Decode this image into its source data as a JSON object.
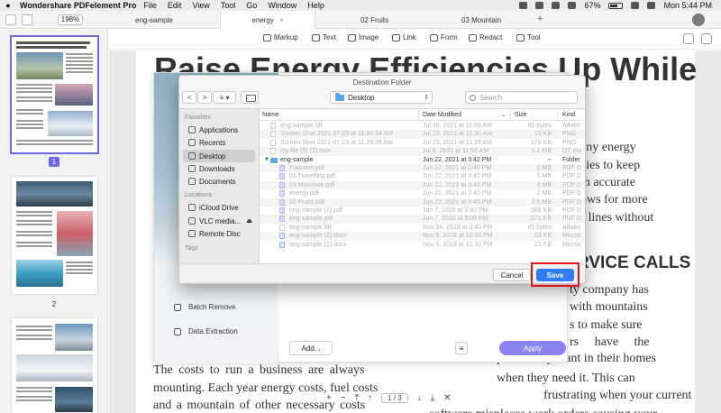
{
  "menubar": {
    "app_name": "Wondershare PDFelement Pro",
    "menus": [
      "File",
      "Edit",
      "View",
      "Tool",
      "Go",
      "Window",
      "Help"
    ],
    "battery": "67%",
    "clock": "Mon 5:44 PM",
    "battery_level": 0.67
  },
  "tabbar": {
    "zoom": "198%",
    "tabs": [
      "eng-sample",
      "energy",
      "02 Fruits",
      "03 Mountain"
    ],
    "active_tab": 1,
    "add": "+"
  },
  "toolbar": {
    "tools": [
      "Markup",
      "Text",
      "Image",
      "Link",
      "Form",
      "Redact",
      "Tool"
    ]
  },
  "thumbnails": {
    "pages": [
      "1",
      "2"
    ],
    "selected": 0
  },
  "document": {
    "heading_line1": "Raise Energy Efficiencies Up While",
    "heading_line2": "Re",
    "right_lines": [
      "ows any energy",
      "panies to keep",
      "with accurate",
      "allows for more",
      "the lines without",
      "n."
    ],
    "subhead": "RVICE CALLS",
    "right_lines2": [
      "ty company has",
      "with mountains",
      "s to make sure",
      "rs have the",
      "power they want in their homes",
      "when they need it. This can",
      "frustrating when your current",
      "software misplaces work orders causing your"
    ],
    "left_lines": [
      "The costs to run a business are always",
      "mounting. Each year energy costs, fuel costs",
      "and a mountain of other necessary costs"
    ]
  },
  "pagenav": {
    "current": "1",
    "total": "3",
    "separator": "/",
    "plus": "+",
    "minus": "−",
    "close": "✕"
  },
  "batch_panel": {
    "items": [
      "Batch Remove",
      "Data Extraction"
    ],
    "add_button": "Add...",
    "apply_button": "Apply"
  },
  "dialog": {
    "title": "Destination Folder",
    "back": "<",
    "forward": ">",
    "location": "Desktop",
    "search_placeholder": "Search",
    "sidebar": {
      "favorites_label": "Favorites",
      "favorites": [
        "Applications",
        "Recents",
        "Desktop",
        "Downloads",
        "Documents"
      ],
      "selected": "Desktop",
      "locations_label": "Locations",
      "locations": [
        "iCloud Drive",
        "VLC media...",
        "Remote Disc"
      ],
      "tags_label": "Tags"
    },
    "columns": [
      "Name",
      "Date Modified",
      "Size",
      "Kind"
    ],
    "files": [
      {
        "name": "eng-sample.fdf",
        "date": "Jul 30, 2021 at 11:05 AM",
        "size": "85 bytes",
        "kind": "Adobe",
        "icon": "file",
        "enabled": false,
        "indent": 0
      },
      {
        "name": "Screen Shot 2021-07-23 at 11.30.34 AM",
        "date": "Jul 23, 2021 at 11:30 AM",
        "size": "19 KB",
        "kind": "PNG",
        "icon": "file",
        "enabled": false,
        "indent": 0
      },
      {
        "name": "Screen Shot 2021-07-23 at 11.29.38 AM",
        "date": "Jul 23, 2021 at 11:29 AM",
        "size": "175 KB",
        "kind": "PNG",
        "icon": "file",
        "enabled": false,
        "indent": 0
      },
      {
        "name": "my file (5) (2).mov",
        "date": "Jul 6, 2021 at 11:56 AM",
        "size": "1.1 MB",
        "kind": "QT mo",
        "icon": "file",
        "enabled": false,
        "indent": 0
      },
      {
        "name": "eng-sample",
        "date": "Jun 22, 2021 at 3:42 PM",
        "size": "--",
        "kind": "Folder",
        "icon": "folder",
        "enabled": true,
        "indent": 0
      },
      {
        "name": "Function.pdf",
        "date": "Jun 22, 2021 at 3:40 PM",
        "size": "6 MB",
        "kind": "PDF D",
        "icon": "pdf",
        "enabled": false,
        "indent": 1
      },
      {
        "name": "01 Travelling.pdf",
        "date": "Jun 22, 2021 at 3:40 PM",
        "size": "5 MB",
        "kind": "PDF D",
        "icon": "pdf",
        "enabled": false,
        "indent": 1
      },
      {
        "name": "03 Mountain.pdf",
        "date": "Jun 22, 2021 at 3:40 PM",
        "size": "3 MB",
        "kind": "PDF D",
        "icon": "pdf",
        "enabled": false,
        "indent": 1
      },
      {
        "name": "energy.pdf",
        "date": "Jun 22, 2021 at 3:40 PM",
        "size": "2 MB",
        "kind": "PDF D",
        "icon": "pdf",
        "enabled": false,
        "indent": 1
      },
      {
        "name": "02 Fruits.pdf",
        "date": "Jun 22, 2021 at 3:40 PM",
        "size": "1.6 MB",
        "kind": "PDF D",
        "icon": "pdf",
        "enabled": false,
        "indent": 1
      },
      {
        "name": "eng-sample (1).pdf",
        "date": "Jan 7, 2020 at 3:40 PM",
        "size": "566 KB",
        "kind": "PDF D",
        "icon": "pdf",
        "enabled": false,
        "indent": 1
      },
      {
        "name": "eng-sample.pdf",
        "date": "Jan 7, 2020 at 5:09 PM",
        "size": "571 KB",
        "kind": "PDF D",
        "icon": "pdf",
        "enabled": false,
        "indent": 1
      },
      {
        "name": "eng-sample.fdf",
        "date": "Nov 14, 2019 at 3:40 PM",
        "size": "85 bytes",
        "kind": "Adobe",
        "icon": "file",
        "enabled": false,
        "indent": 1
      },
      {
        "name": "eng-sample (2).docx",
        "date": "Nov 5, 2019 at 12:33 PM",
        "size": "23 KB",
        "kind": "Micros",
        "icon": "doc",
        "enabled": false,
        "indent": 1
      },
      {
        "name": "eng-sample (1).docx",
        "date": "Nov 5, 2019 at 12:33 PM",
        "size": "23 KB",
        "kind": "Micros",
        "icon": "doc",
        "enabled": false,
        "indent": 1
      }
    ],
    "cancel_button": "Cancel",
    "save_button": "Save"
  }
}
